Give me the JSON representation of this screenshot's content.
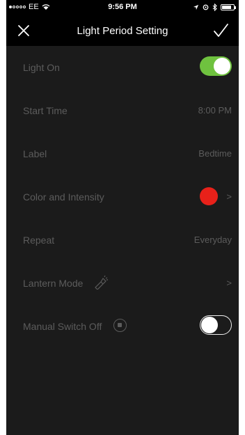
{
  "status_bar": {
    "carrier": "EE",
    "signal_bars_filled": 1,
    "signal_bars_total": 5,
    "time": "9:56 PM",
    "battery_level": 0.8,
    "icons": [
      "wifi-icon",
      "location-icon",
      "alarm-icon",
      "bluetooth-icon",
      "battery-icon"
    ]
  },
  "nav": {
    "title": "Light Period Setting",
    "close_icon": "close-icon",
    "done_icon": "checkmark-icon"
  },
  "rows": {
    "light_on": {
      "label": "Light On",
      "toggle_on": true
    },
    "start_time": {
      "label": "Start Time",
      "value": "8:00 PM"
    },
    "label": {
      "label": "Label",
      "value": "Bedtime"
    },
    "color_intensity": {
      "label": "Color and Intensity",
      "chevron": ">"
    },
    "repeat": {
      "label": "Repeat",
      "value": "Everyday"
    },
    "lantern_mode": {
      "label": "Lantern Mode",
      "chevron": ">"
    },
    "manual_switch_off": {
      "label": "Manual Switch Off",
      "toggle_on": false
    }
  },
  "colors": {
    "background": "#1b1b1b",
    "header": "#000000",
    "toggle_on": "#6fc23f",
    "selected_light_color": "#e8211a",
    "text_dim": "#5c5c5c"
  }
}
